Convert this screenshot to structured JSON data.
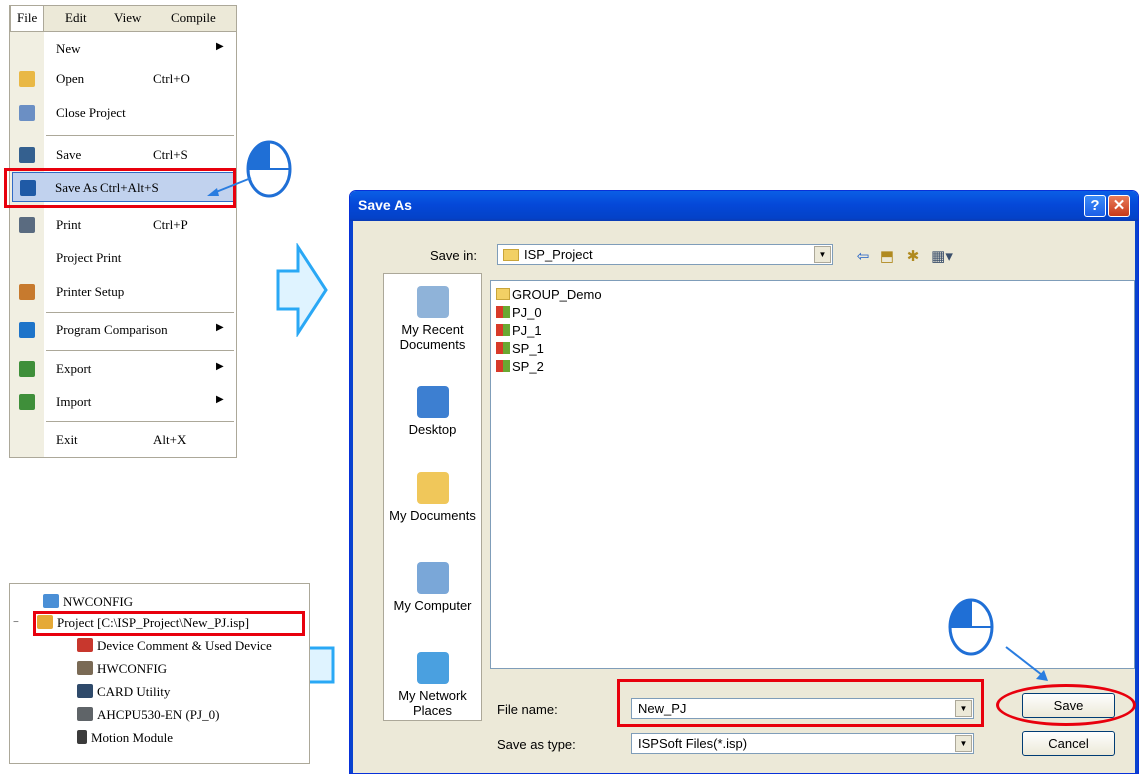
{
  "menubar": {
    "items": [
      {
        "label": "File",
        "mnemonic": "F"
      },
      {
        "label": "Edit",
        "mnemonic": "E"
      },
      {
        "label": "View",
        "mnemonic": "V"
      },
      {
        "label": "Compile",
        "mnemonic": "C"
      }
    ]
  },
  "file_menu": {
    "items": [
      {
        "label": "New",
        "shortcut": "",
        "has_submenu": true,
        "icon": "none"
      },
      {
        "label": "Open",
        "shortcut": "Ctrl+O",
        "icon": "open-folder-icon"
      },
      {
        "label": "Close Project",
        "shortcut": "",
        "icon": "close-project-icon"
      },
      {
        "label": "Save",
        "shortcut": "Ctrl+S",
        "icon": "save-disk-icon"
      },
      {
        "label": "Save As",
        "shortcut": "Ctrl+Alt+S",
        "icon": "save-as-icon",
        "highlighted": true
      },
      {
        "label": "Print",
        "shortcut": "Ctrl+P",
        "icon": "printer-icon"
      },
      {
        "label": "Project Print",
        "shortcut": "",
        "icon": "none"
      },
      {
        "label": "Printer Setup",
        "shortcut": "",
        "icon": "printer-setup-icon"
      },
      {
        "label": "Program Comparison",
        "shortcut": "",
        "has_submenu": true,
        "icon": "comparison-icon"
      },
      {
        "label": "Export",
        "shortcut": "",
        "has_submenu": true,
        "icon": "export-icon"
      },
      {
        "label": "Import",
        "shortcut": "",
        "has_submenu": true,
        "icon": "import-icon"
      },
      {
        "label": "Exit",
        "shortcut": "Alt+X",
        "icon": "none"
      }
    ]
  },
  "tree": {
    "nodes": [
      {
        "label": "NWCONFIG",
        "icon": "network-config-icon"
      },
      {
        "label": "Project [C:\\ISP_Project\\New_PJ.isp]",
        "icon": "project-icon",
        "expander": "−"
      },
      {
        "label": "Device Comment & Used Device",
        "icon": "device-comment-icon"
      },
      {
        "label": "HWCONFIG",
        "icon": "hardware-config-icon"
      },
      {
        "label": "CARD Utility",
        "icon": "card-utility-icon"
      },
      {
        "label": "AHCPU530-EN  (PJ_0)",
        "icon": "cpu-icon"
      },
      {
        "label": "Motion Module",
        "icon": "motion-module-icon"
      }
    ]
  },
  "dialog": {
    "title": "Save As",
    "help_glyph": "?",
    "close_glyph": "✕",
    "save_in_label": "Save in:",
    "save_in_value": "ISP_Project",
    "places": [
      {
        "label": "My Recent Documents",
        "line1": "My Recent",
        "line2": "Documents"
      },
      {
        "label": "Desktop",
        "line1": "Desktop",
        "line2": ""
      },
      {
        "label": "My Documents",
        "line1": "My Documents",
        "line2": ""
      },
      {
        "label": "My Computer",
        "line1": "My Computer",
        "line2": ""
      },
      {
        "label": "My Network Places",
        "line1": "My Network",
        "line2": "Places"
      }
    ],
    "files": [
      {
        "name": "GROUP_Demo",
        "type": "folder"
      },
      {
        "name": "PJ_0",
        "type": "project"
      },
      {
        "name": "PJ_1",
        "type": "project"
      },
      {
        "name": "SP_1",
        "type": "project"
      },
      {
        "name": "SP_2",
        "type": "project"
      }
    ],
    "file_name_label": "File name:",
    "file_name_value": "New_PJ",
    "save_type_label": "Save as type:",
    "save_type_value": "ISPSoft Files(*.isp)",
    "save_button": "Save",
    "cancel_button": "Cancel"
  },
  "colors": {
    "highlight_red": "#e8000d",
    "arrow_blue": "#2aa8f5",
    "title_blue": "#0548d8"
  }
}
